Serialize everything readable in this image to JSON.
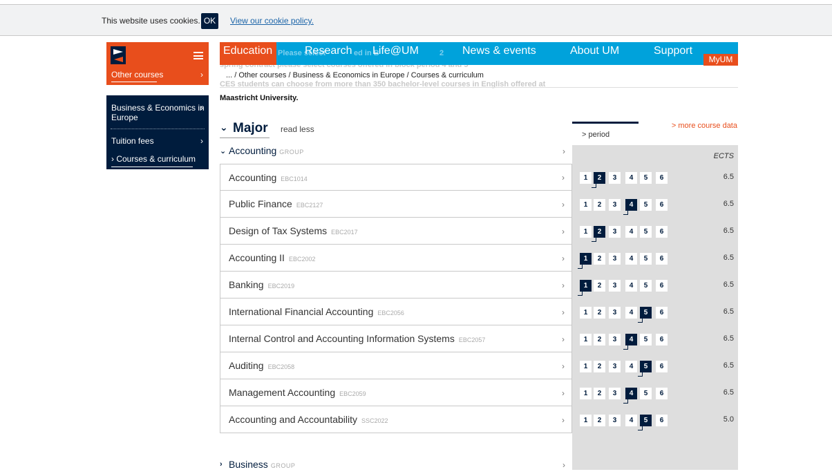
{
  "cookie": {
    "text": "This website uses cookies.",
    "ok_label": "OK",
    "link_label": "View our cookie policy."
  },
  "ghost_text": {
    "line1": "spring contract please select courses offered in block period 4 and 5",
    "line2": "CES students can choose from more than 350 bachelor-level courses in English offered at",
    "line_behind_nav_left": "Please select",
    "line_behind_nav_mid": "ed in B",
    "line_behind_nav_right": "2"
  },
  "sidebar": {
    "other_courses": "Other courses",
    "arrow": "›",
    "items": [
      {
        "label_line1": "Business & Economics in",
        "label_line2": "Europe",
        "arrow": "›"
      },
      {
        "label": "Tuition fees",
        "arrow": "›"
      },
      {
        "label": "Courses & curriculum",
        "prefix": "›"
      }
    ]
  },
  "nav": {
    "items": [
      "Education",
      "Research",
      "Life@UM",
      "News & events",
      "About UM",
      "Support"
    ],
    "myum": "MyUM"
  },
  "breadcrumb": "... / Other courses / Business & Economics in Europe / Courses & curriculum",
  "intro_bold": "Maastricht University.",
  "major": {
    "chevron": "⌄",
    "title": "Major",
    "read_less": "read less"
  },
  "more_course_data": "> more course data",
  "period_tab": "> period",
  "ects_label": "ECTS",
  "groups": {
    "accounting": {
      "name": "Accounting",
      "tag": "GROUP",
      "arrow": "›"
    },
    "business": {
      "name": "Business",
      "tag": "GROUP",
      "arrow": "›"
    }
  },
  "period_numbers": [
    "1",
    "2",
    "3",
    "4",
    "5",
    "6"
  ],
  "courses": [
    {
      "name": "Accounting",
      "code": "EBC1014",
      "active_period": 2,
      "ects": "6.5"
    },
    {
      "name": "Public Finance",
      "code": "EBC2127",
      "active_period": 4,
      "ects": "6.5"
    },
    {
      "name": "Design of Tax Systems",
      "code": "EBC2017",
      "active_period": 2,
      "ects": "6.5"
    },
    {
      "name": "Accounting II",
      "code": "EBC2002",
      "active_period": 1,
      "ects": "6.5"
    },
    {
      "name": "Banking",
      "code": "EBC2019",
      "active_period": 1,
      "ects": "6.5"
    },
    {
      "name": "International Financial Accounting",
      "code": "EBC2056",
      "active_period": 5,
      "ects": "6.5"
    },
    {
      "name": "Internal Control and Accounting Information Systems",
      "code": "EBC2057",
      "active_period": 4,
      "ects": "6.5"
    },
    {
      "name": "Auditing",
      "code": "EBC2058",
      "active_period": 5,
      "ects": "6.5"
    },
    {
      "name": "Management Accounting",
      "code": "EBC2059",
      "active_period": 4,
      "ects": "6.5"
    },
    {
      "name": "Accounting and Accountability",
      "code": "SSC2022",
      "active_period": 5,
      "ects": "5.0"
    }
  ],
  "course_row_arrow": "›",
  "colors": {
    "brand_orange": "#e84e1c",
    "brand_navy": "#001c3d",
    "nav_blue": "#00a2db",
    "link_blue": "#1b64a8"
  }
}
